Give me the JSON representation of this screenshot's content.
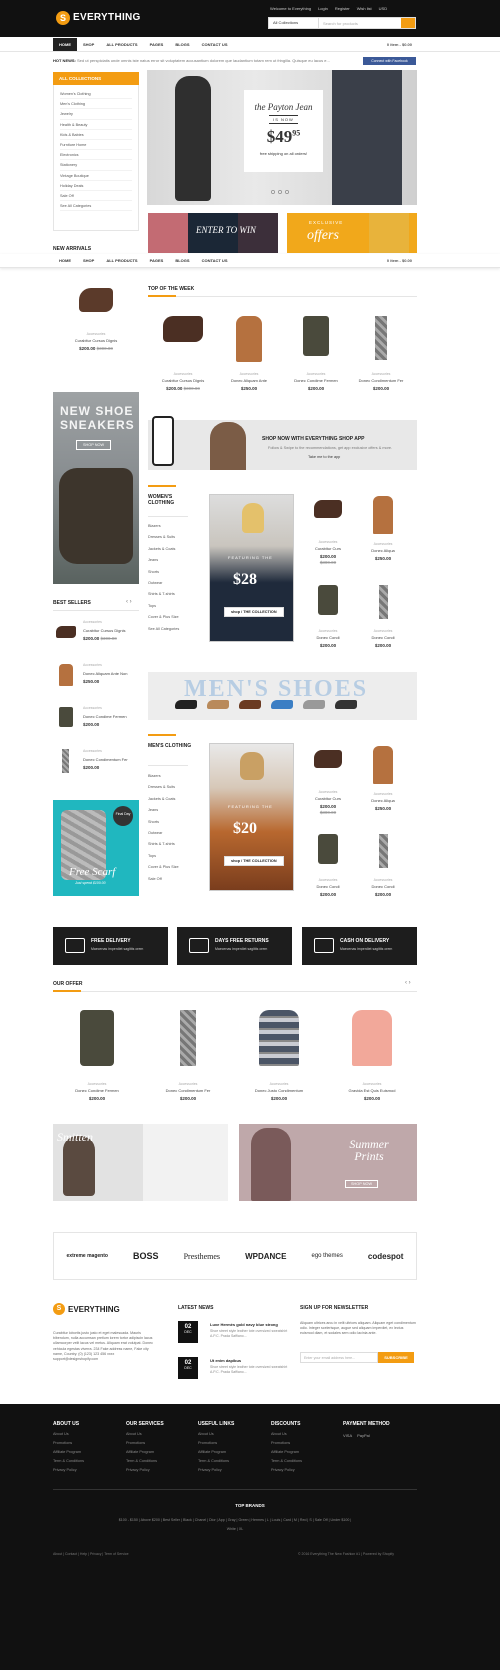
{
  "header": {
    "logo_letter": "S",
    "logo_text": "EVERYTHING",
    "links": [
      "Welcome to Everything",
      "Login",
      "Register",
      "Wish list",
      "USD"
    ],
    "search_category": "All Collections",
    "search_placeholder": "Search for products"
  },
  "nav": {
    "items": [
      "HOME",
      "SHOP",
      "ALL PRODUCTS",
      "PAGES",
      "BLOGS",
      "CONTACT US"
    ],
    "cart": "0 item - $0.00"
  },
  "hot_news": {
    "label": "HOT NEWS:",
    "text": "Sed ut perspiciatis unde omnis iste natus error sit voluptatem accusantium dolorem que laudantium totam rem ut fringilla. Quisque eu lacus e...",
    "facebook": "Connect with Facebook"
  },
  "sidebar": {
    "heading": "ALL COLLECTIONS",
    "items": [
      "Women's Clothing",
      "Men's Clothing",
      "Jewelry",
      "Health & Beauty",
      "Kids & Babies",
      "Furniture Home",
      "Electronics",
      "Stationery",
      "Vintage Boutique",
      "Holiday Deals",
      "Sale Off",
      "See All Categories"
    ]
  },
  "hero": {
    "title": "the Payton Jean",
    "is_now": "IS NOW",
    "price": "$49",
    "price_cents": "95",
    "sub": "free shipping on all orders!"
  },
  "promos": {
    "left": "ENTER TO WIN",
    "right_small": "EXCLUSIVE",
    "right_big": "offers"
  },
  "new_arrivals": {
    "heading": "NEW ARRIVALS",
    "item": {
      "cat": "Accessories",
      "name": "Curabitur Cursus Dignis",
      "price": "$200.00",
      "old": "$300.00"
    }
  },
  "top_week": {
    "heading": "TOP OF THE WEEK",
    "items": [
      {
        "cat": "Accessories",
        "name": "Curabitur Cursus Dignis",
        "price": "$200.00",
        "old": "$300.00"
      },
      {
        "cat": "Accessories",
        "name": "Donec Aliquam Ante",
        "price": "$250.00",
        "old": ""
      },
      {
        "cat": "Accessories",
        "name": "Donec Condime Fermen",
        "price": "$200.00",
        "old": ""
      },
      {
        "cat": "Accessories",
        "name": "Donec Condimentum Fer",
        "price": "$200.00",
        "old": ""
      }
    ]
  },
  "sneakers": {
    "line1": "NEW SHOE",
    "line2": "SNEAKERS",
    "btn": "SHOP NOW"
  },
  "app": {
    "title": "SHOP NOW WITH EVERYTHING SHOP APP",
    "sub": "Follow & Swipe to the recommendations, get app exclusive offers & more.",
    "cta": "Take me to the app"
  },
  "women": {
    "heading": "WOMEN'S CLOTHING",
    "links": [
      "Blazers",
      "Dresses & Suits",
      "Jackets & Coats",
      "Jeans",
      "Shorts",
      "Outwear",
      "Shirts & T-shirts",
      "Tops",
      "Cover & Plus Size",
      "See All Categories"
    ],
    "feature_word": "FEATURING THE",
    "feature_price": "$28",
    "feature_btn": "shop / THE COLLECTION",
    "products": [
      {
        "cat": "Accessories",
        "name": "Curabitur Curs",
        "price": "$200.00",
        "old": "$300.00"
      },
      {
        "cat": "Accessories",
        "name": "Donec Aliqua",
        "price": "$250.00",
        "old": ""
      },
      {
        "cat": "Accessories",
        "name": "Donec Condi",
        "price": "$200.00",
        "old": ""
      },
      {
        "cat": "Accessories",
        "name": "Donec Condi",
        "price": "$200.00",
        "old": ""
      }
    ]
  },
  "best_sellers": {
    "heading": "BEST SELLERS",
    "items": [
      {
        "cat": "Accessories",
        "name": "Curabitur Cursus Dignis",
        "price": "$200.00",
        "old": "$300.00"
      },
      {
        "cat": "Accessories",
        "name": "Donec Aliquam Ante Non",
        "price": "$250.00",
        "old": ""
      },
      {
        "cat": "Accessories",
        "name": "Donec Condime Fermen",
        "price": "$200.00",
        "old": ""
      },
      {
        "cat": "Accessories",
        "name": "Donec Condimentum Fer",
        "price": "$200.00",
        "old": ""
      }
    ]
  },
  "mens_shoes": "MEN'S SHOES",
  "men": {
    "heading": "MEN'S CLOTHING",
    "links": [
      "Blazers",
      "Dresses & Suits",
      "Jackets & Coats",
      "Jeans",
      "Shorts",
      "Outwear",
      "Shirts & T-shirts",
      "Tops",
      "Cover & Plus Size",
      "Sale Off"
    ],
    "feature_word": "FEATURING THE",
    "feature_price": "$20",
    "feature_btn": "shop / THE COLLECTION",
    "products": [
      {
        "cat": "Accessories",
        "name": "Curabitur Curs",
        "price": "$200.00",
        "old": "$300.00"
      },
      {
        "cat": "Accessories",
        "name": "Donec Aliqua",
        "price": "$250.00",
        "old": ""
      },
      {
        "cat": "Accessories",
        "name": "Donec Condi",
        "price": "$200.00",
        "old": ""
      },
      {
        "cat": "Accessories",
        "name": "Donec Condi",
        "price": "$200.00",
        "old": ""
      }
    ]
  },
  "scarf": {
    "badge": "Final Day",
    "title": "Free Scarf",
    "sub": "Just spend $100.00"
  },
  "services": [
    {
      "title": "FREE DELIVERY",
      "sub": "Maecenas imperdiet sagittis orem"
    },
    {
      "title": "DAYS FREE RETURNS",
      "sub": "Maecenas imperdiet sagittis orem"
    },
    {
      "title": "CASH ON DELIVERY",
      "sub": "Maecenas imperdiet sagittis orem"
    }
  ],
  "our_offer": {
    "heading": "OUR OFFER",
    "items": [
      {
        "cat": "Accessories",
        "name": "Donec Condime Fermen",
        "price": "$200.00"
      },
      {
        "cat": "Accessories",
        "name": "Donec Condimentum Fer",
        "price": "$200.00"
      },
      {
        "cat": "Accessories",
        "name": "Donec Justo Condimentum",
        "price": "$200.00"
      },
      {
        "cat": "Accessories",
        "name": "Gravida Est Quis Euismod",
        "price": "$200.00"
      }
    ]
  },
  "banners": {
    "left": "Smitten",
    "right": "Summer Prints",
    "right_btn": "SHOP NOW"
  },
  "brands": [
    "extreme magento",
    "BOSS",
    "Presthemes",
    "WPDANCE",
    "ego themes",
    "codespot"
  ],
  "footer": {
    "about_text": "Curabitur lobortis justo justo et eget malesuada. Mauris bibendum, nulla accumsan pretium lorem tortor adipiscin lacus ullamcorper velit lacus vel metus. Aliquam erat volutpat. Donec vehicula egestas viverra. 234 Fake address name, Fake city name, Country. (0) (123) 123 456 xxxx support@designshopify.com",
    "latest_news": "LATEST NEWS",
    "news": [
      {
        "day": "02",
        "mon": "DEC",
        "title": "Luxe Hermès gold navy blue strong",
        "text": "Shoe street style leather tote oversized sweatshirt A.P.C. Prada Saffiano..."
      },
      {
        "day": "02",
        "mon": "DEC",
        "title": "Ut enim dapibus",
        "text": "Shoe street style leather tote oversized sweatshirt A.P.C. Prada Saffiano..."
      }
    ],
    "newsletter_head": "SIGN UP FOR NEWSLETTER",
    "newsletter_text": "Aliquam ultrices arcu in velit ultrices aliquam. Aliquam eget condimentum odio. Integer scelerisque, augue sed aliquam imperdiet, ex lectus euismod diam, et sodales sem odio lacinia ante.",
    "email_ph": "Enter your email address here...",
    "subscribe": "SUBSCRIBE",
    "columns": [
      {
        "head": "ABOUT US",
        "items": [
          "About Us",
          "Promotions",
          "Affiliate Program",
          "Term & Conditions",
          "Privacy Policy"
        ]
      },
      {
        "head": "OUR SERVICES",
        "items": [
          "About Us",
          "Promotions",
          "Affiliate Program",
          "Term & Conditions",
          "Privacy Policy"
        ]
      },
      {
        "head": "USEFUL LINKS",
        "items": [
          "About Us",
          "Promotions",
          "Affiliate Program",
          "Term & Conditions",
          "Privacy Policy"
        ]
      },
      {
        "head": "DISCOUNTS",
        "items": [
          "About Us",
          "Promotions",
          "Affiliate Program",
          "Term & Conditions",
          "Privacy Policy"
        ]
      }
    ],
    "payment_head": "PAYMENT METHOD",
    "payments": [
      "VISA",
      "PayPal"
    ],
    "top_brands": "TOP BRANDS",
    "tags1": "$100 - $150 | Above $200 | Best Seller | Black | Chanel | Dior | App | Gray | Green | Hermes | L | Louis | Card | M | Red | S | Sale Off | Under $100 |",
    "tags2": "White | XL",
    "bottom_links": "About | Contact | Help | Privacy | Term of Service",
    "copyright": "© 2016 Everything The New Fashion #1 | Powered by Shopify"
  }
}
